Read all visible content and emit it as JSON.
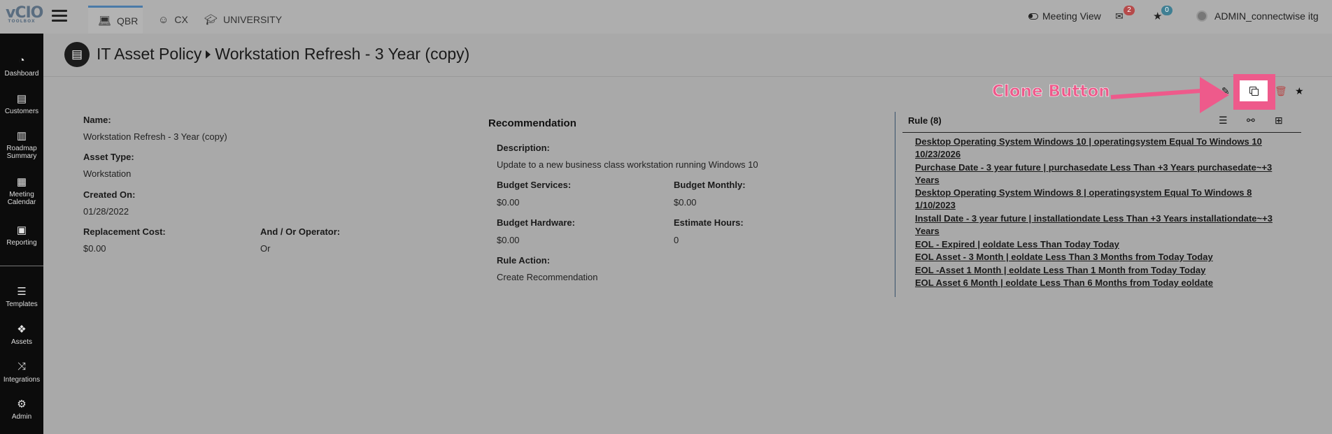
{
  "topbar": {
    "logo": "vCIO",
    "logo_sub": "TOOLBOX",
    "tabs": [
      {
        "label": "QBR",
        "icon": "laptop-icon"
      },
      {
        "label": "CX",
        "icon": "smiley-icon"
      },
      {
        "label": "UNIVERSITY",
        "icon": "graduation-cap-icon"
      }
    ],
    "meeting_view": "Meeting View",
    "mail_count": "2",
    "star_count": "0",
    "username": "ADMIN_connectwise itg"
  },
  "sidebar": {
    "items": [
      {
        "label": "Dashboard",
        "icon": "dashboard-icon"
      },
      {
        "label": "Customers",
        "icon": "id-card-icon"
      },
      {
        "label": "Roadmap Summary",
        "icon": "map-icon"
      },
      {
        "label": "Meeting Calendar",
        "icon": "calendar-icon"
      },
      {
        "label": "Reporting",
        "icon": "newspaper-icon"
      },
      {
        "label": "Templates",
        "icon": "template-icon"
      },
      {
        "label": "Assets",
        "icon": "cubes-icon"
      },
      {
        "label": "Integrations",
        "icon": "shuffle-icon"
      },
      {
        "label": "Admin",
        "icon": "gears-icon"
      }
    ]
  },
  "header": {
    "icon": "book-icon",
    "breadcrumb_parent": "IT Asset Policy",
    "title": "Workstation Refresh - 3 Year (copy)"
  },
  "annotation": {
    "label": "Clone Button",
    "color": "#ee5a8b"
  },
  "details": {
    "name_label": "Name:",
    "name_value": "Workstation Refresh - 3 Year (copy)",
    "asset_type_label": "Asset Type:",
    "asset_type_value": "Workstation",
    "created_on_label": "Created On:",
    "created_on_value": "01/28/2022",
    "replacement_cost_label": "Replacement Cost:",
    "replacement_cost_value": "$0.00",
    "operator_label": "And / Or Operator:",
    "operator_value": "Or"
  },
  "recommendation": {
    "title": "Recommendation",
    "description_label": "Description:",
    "description_value": "Update to a new business class workstation running Windows 10",
    "budget_services_label": "Budget Services:",
    "budget_services_value": "$0.00",
    "budget_monthly_label": "Budget Monthly:",
    "budget_monthly_value": "$0.00",
    "budget_hardware_label": "Budget Hardware:",
    "budget_hardware_value": "$0.00",
    "estimate_hours_label": "Estimate Hours:",
    "estimate_hours_value": "0",
    "rule_action_label": "Rule Action:",
    "rule_action_value": "Create Recommendation"
  },
  "rules": {
    "title": "Rule (8)",
    "items": [
      "Desktop Operating System Windows 10  |  operatingsystem Equal To Windows 10 10/23/2026",
      "Purchase Date - 3 year future  |  purchasedate Less Than +3 Years purchasedate~+3 Years",
      "Desktop Operating System Windows 8  |  operatingsystem Equal To Windows 8 1/10/2023",
      "Install Date - 3 year future  |  installationdate Less Than +3 Years installationdate~+3 Years",
      "EOL - Expired  |  eoldate Less Than Today Today",
      "EOL Asset - 3 Month  |  eoldate Less Than 3 Months from Today Today",
      "EOL -Asset 1 Month  |  eoldate Less Than 1 Month from Today Today",
      "EOL Asset 6 Month  |  eoldate Less Than 6 Months from Today eoldate"
    ]
  }
}
